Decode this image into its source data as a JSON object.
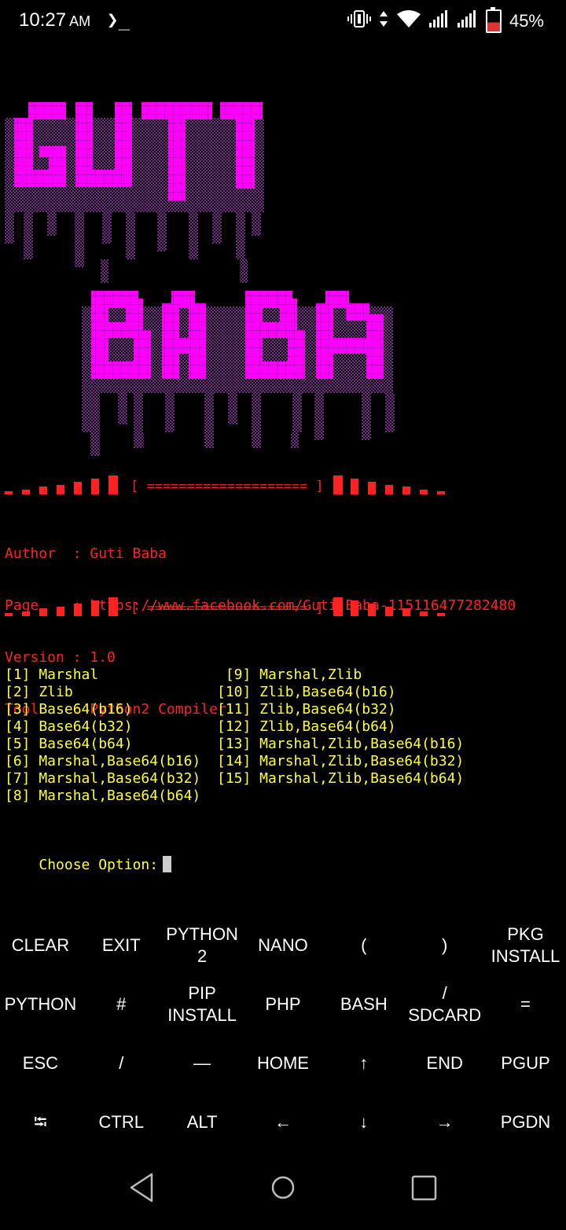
{
  "status_bar": {
    "time": "10:27",
    "ampm": "AM",
    "terminal_icon": "❯_",
    "battery_percent": "45%",
    "battery_level": 0.45,
    "icons": [
      "vibrate-icon",
      "data-arrows-icon",
      "wifi-icon",
      "signal-icon",
      "signal-icon",
      "battery-icon"
    ]
  },
  "banner": {
    "line1": "GUTI",
    "line2": "BABA",
    "color": "#ff00ff"
  },
  "separator": {
    "text": "[ ==================== ]"
  },
  "info": {
    "author": "Author  : Guti Baba",
    "page": "Page    : https://www.facebook.com/Guti-Baba-115116477282480",
    "version": "Version : 1.0",
    "tool": "Tool    : Python2 Compiler"
  },
  "menu": {
    "left": [
      "[1] Marshal",
      "[2] Zlib",
      "[3] Base64(b16)",
      "[4] Base64(b32)",
      "[5] Base64(b64)",
      "[6] Marshal,Base64(b16)",
      "[7] Marshal,Base64(b32)",
      "[8] Marshal,Base64(b64)"
    ],
    "right": [
      " [9] Marshal,Zlib",
      "[10] Zlib,Base64(b16)",
      "[11] Zlib,Base64(b32)",
      "[12] Zlib,Base64(b64)",
      "[13] Marshal,Zlib,Base64(b16)",
      "[14] Marshal,Zlib,Base64(b32)",
      "[15] Marshal,Zlib,Base64(b64)",
      ""
    ]
  },
  "prompt": "Choose Option:",
  "extra_keys": [
    [
      "CLEAR",
      "EXIT",
      "PYTHON\n2",
      "NANO",
      "(",
      ")",
      "PKG\nINSTALL"
    ],
    [
      "PYTHON",
      "#",
      "PIP\nINSTALL",
      "PHP",
      "BASH",
      "/\nSDCARD",
      "="
    ],
    [
      "ESC",
      "/",
      "—",
      "HOME",
      "↑",
      "END",
      "PGUP"
    ],
    [
      "⭾",
      "CTRL",
      "ALT",
      "←",
      "↓",
      "→",
      "PGDN"
    ]
  ],
  "colors": {
    "red": "#ff2222",
    "yellow": "#ffff33",
    "magenta": "#ff00ff"
  }
}
